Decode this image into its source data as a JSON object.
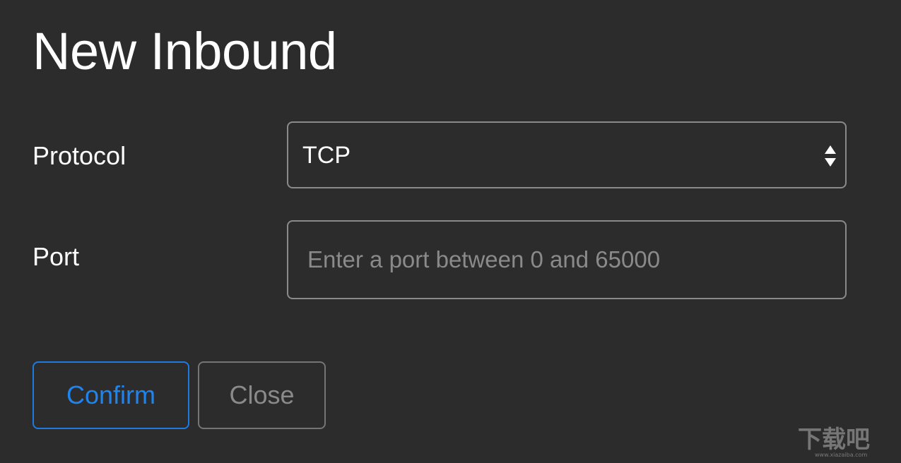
{
  "dialog": {
    "title": "New Inbound"
  },
  "form": {
    "protocol": {
      "label": "Protocol",
      "selected": "TCP"
    },
    "port": {
      "label": "Port",
      "value": "",
      "placeholder": "Enter a port between 0 and 65000"
    }
  },
  "actions": {
    "confirm_label": "Confirm",
    "close_label": "Close"
  },
  "colors": {
    "background": "#2c2c2c",
    "accent": "#1f7ae0",
    "border": "#8a8a8a",
    "muted_text": "#8a8a8a"
  },
  "icons": {
    "select_arrows": "up-down-arrows-icon"
  },
  "watermark": {
    "text": "下载吧",
    "subtext": "www.xiazaiba.com"
  }
}
